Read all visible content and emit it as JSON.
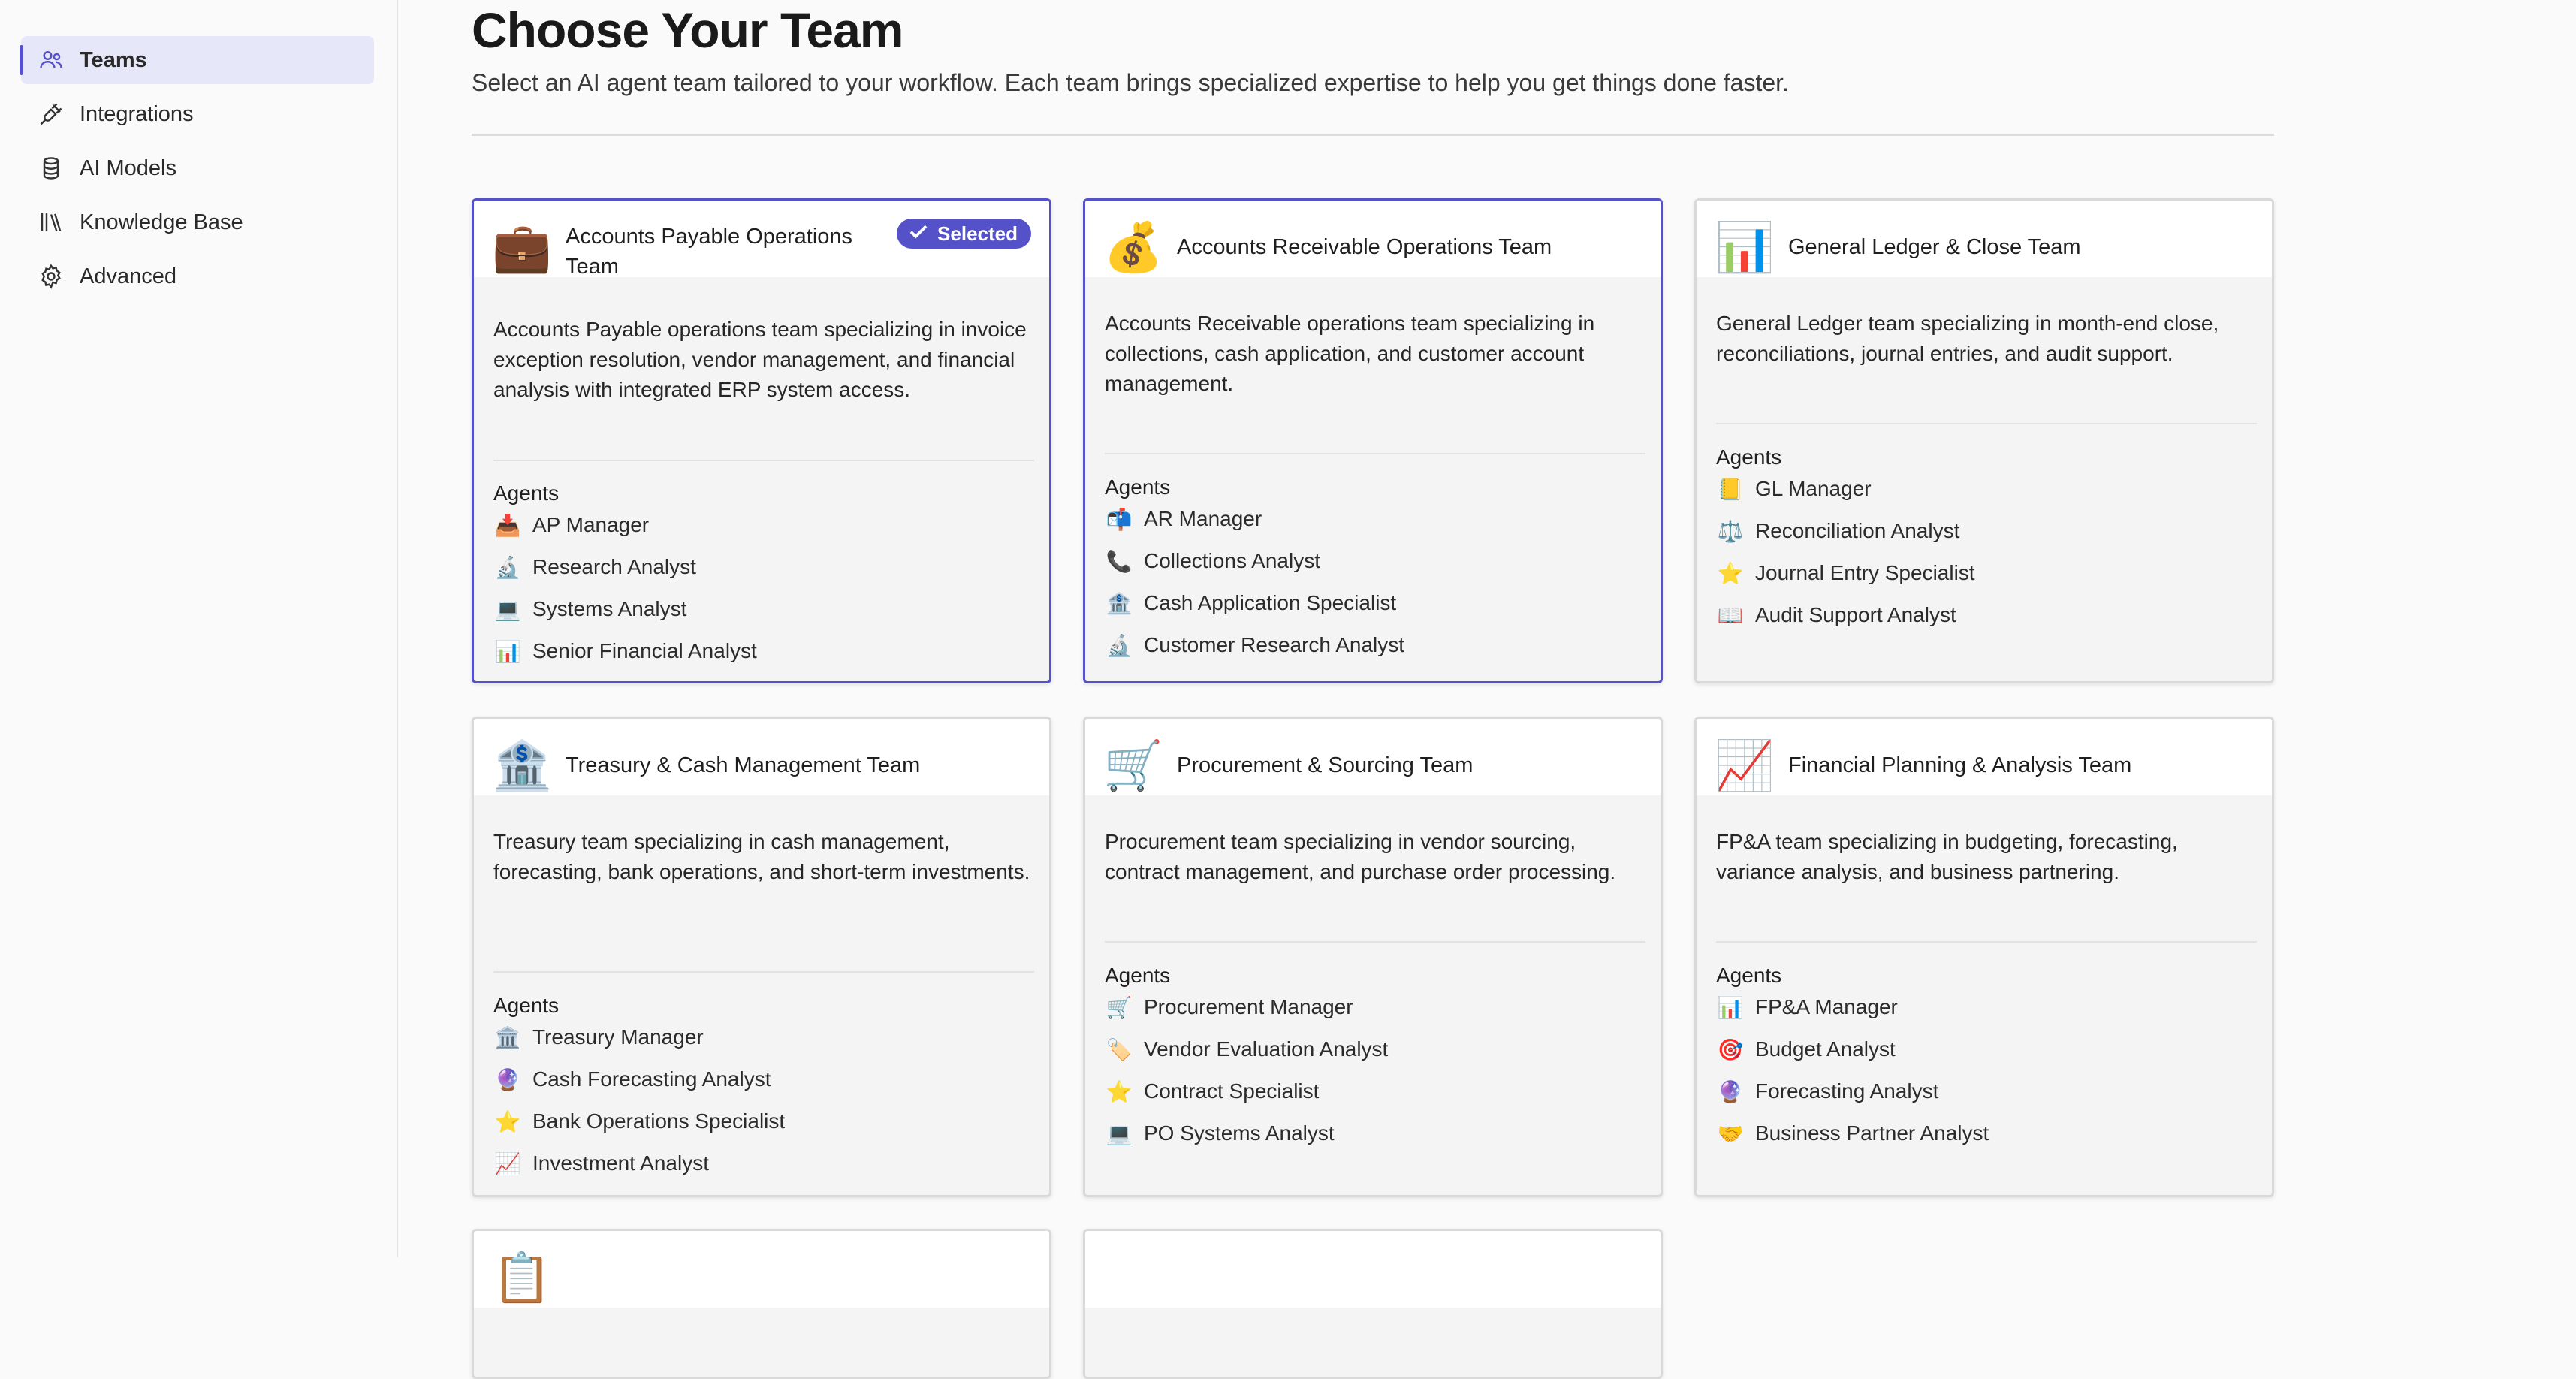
{
  "sidebar": {
    "items": [
      {
        "label": "Teams",
        "icon": "users-icon",
        "active": true
      },
      {
        "label": "Integrations",
        "icon": "plug-icon"
      },
      {
        "label": "AI Models",
        "icon": "database-icon"
      },
      {
        "label": "Knowledge Base",
        "icon": "library-icon"
      },
      {
        "label": "Advanced",
        "icon": "gear-icon"
      }
    ]
  },
  "header": {
    "title": "Choose Your Team",
    "subtitle": "Select an AI agent team tailored to your workflow. Each team brings specialized expertise to help you get things done faster."
  },
  "accent_color": "#5552c9",
  "cards": [
    {
      "emoji": "💼",
      "title": "Accounts Payable Operations Team",
      "selected": true,
      "badge": "Selected",
      "description": "Accounts Payable operations team specializing in invoice exception resolution, vendor management, and financial analysis with integrated ERP system access.",
      "agents_heading": "Agents",
      "agents": [
        {
          "emoji": "📥",
          "name": "AP Manager"
        },
        {
          "emoji": "🔬",
          "name": "Research Analyst"
        },
        {
          "emoji": "💻",
          "name": "Systems Analyst"
        },
        {
          "emoji": "📊",
          "name": "Senior Financial Analyst"
        }
      ]
    },
    {
      "emoji": "💰",
      "title": "Accounts Receivable Operations Team",
      "selected": true,
      "description": "Accounts Receivable operations team specializing in collections, cash application, and customer account management.",
      "agents_heading": "Agents",
      "agents": [
        {
          "emoji": "📬",
          "name": "AR Manager"
        },
        {
          "emoji": "📞",
          "name": "Collections Analyst"
        },
        {
          "emoji": "🏦",
          "name": "Cash Application Specialist"
        },
        {
          "emoji": "🔬",
          "name": "Customer Research Analyst"
        }
      ]
    },
    {
      "emoji": "📊",
      "title": "General Ledger & Close Team",
      "selected": false,
      "description": "General Ledger team specializing in month-end close, reconciliations, journal entries, and audit support.",
      "agents_heading": "Agents",
      "agents": [
        {
          "emoji": "📒",
          "name": "GL Manager"
        },
        {
          "emoji": "⚖️",
          "name": "Reconciliation Analyst"
        },
        {
          "emoji": "⭐",
          "name": "Journal Entry Specialist"
        },
        {
          "emoji": "📖",
          "name": "Audit Support Analyst"
        }
      ]
    },
    {
      "emoji": "🏦",
      "title": "Treasury & Cash Management Team",
      "selected": false,
      "description": "Treasury team specializing in cash management, forecasting, bank operations, and short-term investments.",
      "agents_heading": "Agents",
      "agents": [
        {
          "emoji": "🏛️",
          "name": "Treasury Manager"
        },
        {
          "emoji": "🔮",
          "name": "Cash Forecasting Analyst"
        },
        {
          "emoji": "⭐",
          "name": "Bank Operations Specialist"
        },
        {
          "emoji": "📈",
          "name": "Investment Analyst"
        }
      ]
    },
    {
      "emoji": "🛒",
      "title": "Procurement & Sourcing Team",
      "selected": false,
      "description": "Procurement team specializing in vendor sourcing, contract management, and purchase order processing.",
      "agents_heading": "Agents",
      "agents": [
        {
          "emoji": "🛒",
          "name": "Procurement Manager"
        },
        {
          "emoji": "🏷️",
          "name": "Vendor Evaluation Analyst"
        },
        {
          "emoji": "⭐",
          "name": "Contract Specialist"
        },
        {
          "emoji": "💻",
          "name": "PO Systems Analyst"
        }
      ]
    },
    {
      "emoji": "📈",
      "title": "Financial Planning & Analysis Team",
      "selected": false,
      "description": "FP&A team specializing in budgeting, forecasting, variance analysis, and business partnering.",
      "agents_heading": "Agents",
      "agents": [
        {
          "emoji": "📊",
          "name": "FP&A Manager"
        },
        {
          "emoji": "🎯",
          "name": "Budget Analyst"
        },
        {
          "emoji": "🔮",
          "name": "Forecasting Analyst"
        },
        {
          "emoji": "🤝",
          "name": "Business Partner Analyst"
        }
      ]
    },
    {
      "emoji": "📋",
      "title": "",
      "selected": false,
      "description": "",
      "agents_heading": "",
      "agents": []
    },
    {
      "emoji": "",
      "title": "",
      "selected": false,
      "description": "",
      "agents_heading": "",
      "agents": []
    }
  ]
}
